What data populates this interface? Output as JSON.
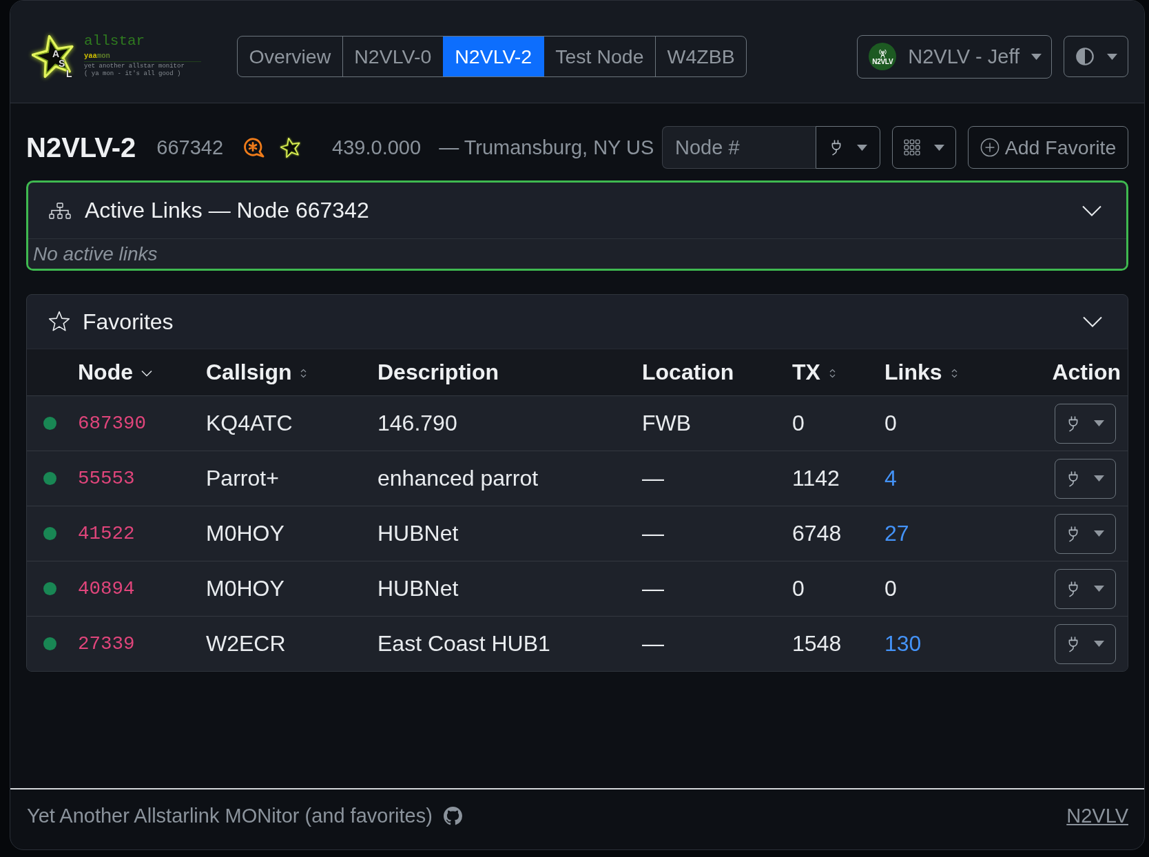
{
  "logo": {
    "letters": [
      "A",
      "S",
      "L"
    ],
    "title": "allstar",
    "name_parts": [
      {
        "text": "yaa",
        "color": "#d2c200"
      },
      {
        "text": "mon",
        "color": "#5f7f2a"
      }
    ],
    "tagline": "yet another allstar monitor",
    "motto": "( ya mon - it's all good )"
  },
  "tabs": [
    {
      "label": "Overview",
      "selected": false
    },
    {
      "label": "N2VLV-0",
      "selected": false
    },
    {
      "label": "N2VLV-2",
      "selected": true
    },
    {
      "label": "Test Node",
      "selected": false
    },
    {
      "label": "W4ZBB",
      "selected": false
    }
  ],
  "user_menu": {
    "avatar_text": "N2VLV",
    "label": "N2VLV - Jeff"
  },
  "node": {
    "callsign": "N2VLV-2",
    "number": "667342",
    "frequency": "439.0.000",
    "location": "— Trumansburg, NY US"
  },
  "node_search": {
    "placeholder": "Node #"
  },
  "add_favorite": {
    "label": "Add Favorite"
  },
  "active_links": {
    "title": "Active Links — Node 667342",
    "expanded": true,
    "empty_text": "No active links"
  },
  "favorites": {
    "title": "Favorites",
    "expanded": true,
    "table": {
      "columns": [
        {
          "label": "Node",
          "sortable": true,
          "sorted": true
        },
        {
          "label": "Callsign",
          "sortable": true,
          "sorted": false
        },
        {
          "label": "Description",
          "sortable": false,
          "sorted": false
        },
        {
          "label": "Location",
          "sortable": false,
          "sorted": false
        },
        {
          "label": "TX",
          "sortable": true,
          "sorted": false
        },
        {
          "label": "Links",
          "sortable": true,
          "sorted": false
        },
        {
          "label": "Action",
          "sortable": false,
          "sorted": false
        }
      ],
      "rows": [
        {
          "online": true,
          "node": "687390",
          "callsign": "KQ4ATC",
          "description": "146.790",
          "location": "FWB",
          "tx": "0",
          "links": "0",
          "links_active": false
        },
        {
          "online": true,
          "node": "55553",
          "callsign": "Parrot+",
          "description": "enhanced parrot",
          "location": "—",
          "tx": "1142",
          "links": "4",
          "links_active": true
        },
        {
          "online": true,
          "node": "41522",
          "callsign": "M0HOY",
          "description": "HUBNet",
          "location": "—",
          "tx": "6748",
          "links": "27",
          "links_active": true
        },
        {
          "online": true,
          "node": "40894",
          "callsign": "M0HOY",
          "description": "HUBNet",
          "location": "—",
          "tx": "0",
          "links": "0",
          "links_active": false
        },
        {
          "online": true,
          "node": "27339",
          "callsign": "W2ECR",
          "description": "East Coast HUB1",
          "location": "—",
          "tx": "1548",
          "links": "130",
          "links_active": true
        }
      ]
    }
  },
  "footer": {
    "text": "Yet Another Allstarlink MONitor (and favorites)",
    "link": "N2VLV"
  }
}
